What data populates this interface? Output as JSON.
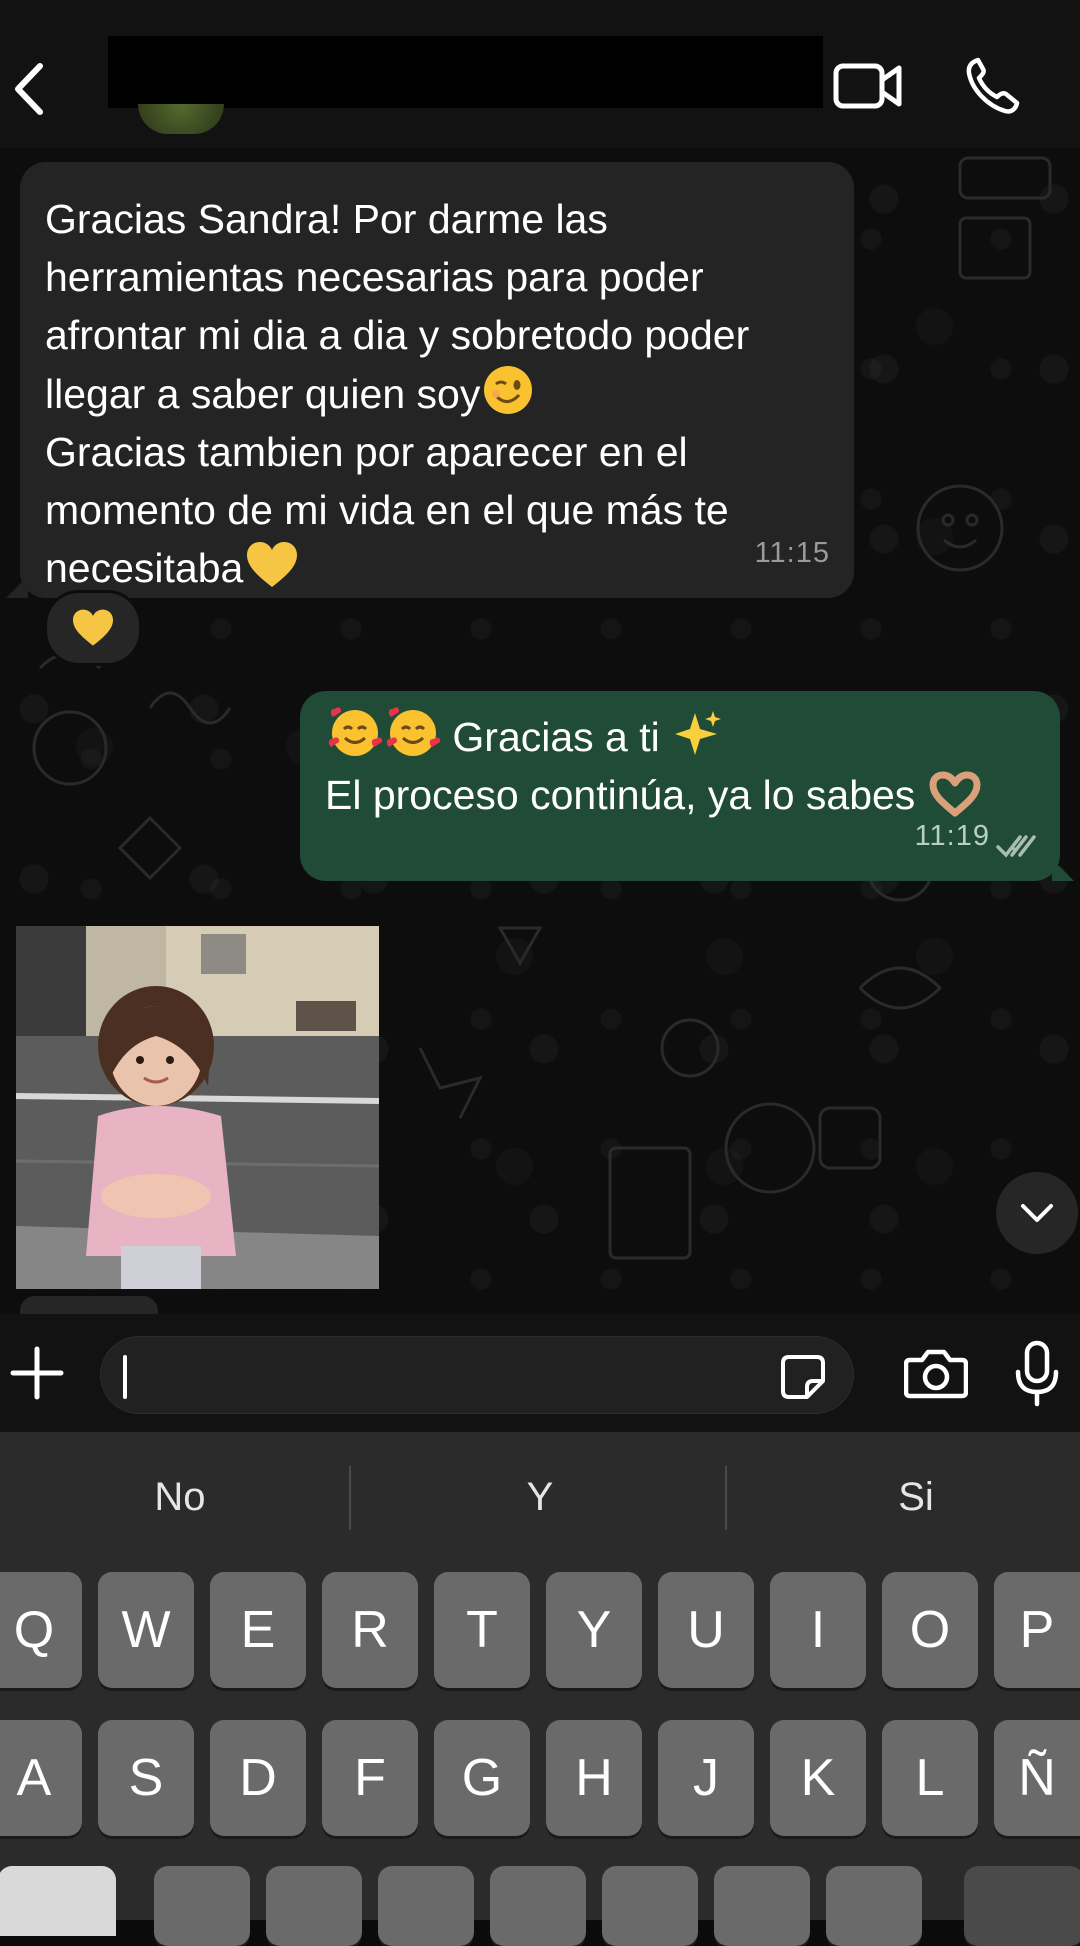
{
  "header": {
    "back_icon": "chevron-left-icon",
    "video_icon": "video-camera-icon",
    "call_icon": "phone-icon"
  },
  "messages": [
    {
      "direction": "incoming",
      "lines": [
        "Gracias Sandra! Por darme las",
        "herramientas necesarias para poder",
        "afrontar mi dia a dia y sobretodo poder",
        "llegar a saber quien soy",
        "Gracias tambien por aparecer en el",
        "momento de mi vida en el que más te",
        "necesitaba"
      ],
      "time": "11:15",
      "reaction": "yellow-heart-emoji"
    },
    {
      "direction": "outgoing",
      "lines": [
        "Gracias a ti",
        "El proceso continúa, ya lo sabes"
      ],
      "time": "11:19",
      "status": "read"
    }
  ],
  "composer": {
    "plus_icon": "plus-icon",
    "sticker_icon": "sticker-icon",
    "camera_icon": "camera-icon",
    "mic_icon": "microphone-icon"
  },
  "keyboard": {
    "suggestions": [
      "No",
      "Y",
      "Si"
    ],
    "row1": [
      "Q",
      "W",
      "E",
      "R",
      "T",
      "Y",
      "U",
      "I",
      "O",
      "P"
    ],
    "row2": [
      "A",
      "S",
      "D",
      "F",
      "G",
      "H",
      "J",
      "K",
      "L",
      "Ñ"
    ]
  },
  "colors": {
    "incoming_bubble": "#242424",
    "outgoing_bubble": "#1f4b37",
    "key": "#6a6a6a",
    "keyboard_bg": "#2b2b2b"
  }
}
